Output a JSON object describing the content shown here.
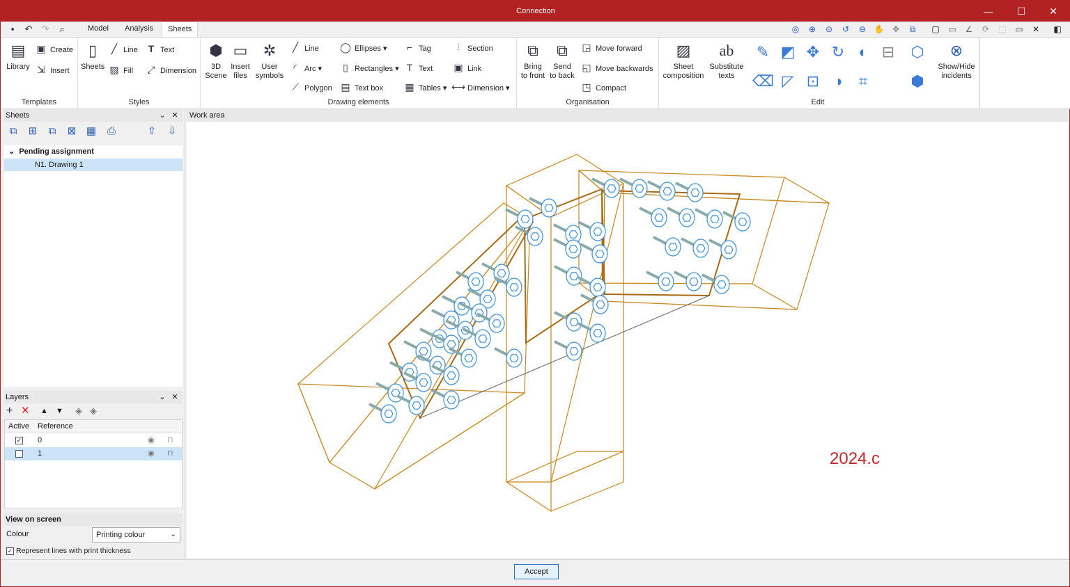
{
  "window": {
    "title": "Connection",
    "minimize_glyph": "—",
    "maximize_glyph": "☐",
    "close_glyph": "✕"
  },
  "tabs": [
    "Model",
    "Analysis",
    "Sheets"
  ],
  "ribbon": {
    "templates": {
      "label": "Templates",
      "library": "Library",
      "create": "Create",
      "insert": "Insert"
    },
    "styles": {
      "label": "Styles",
      "sheets": "Sheets",
      "line": "Line",
      "fill": "Fill",
      "text": "Text",
      "dimension": "Dimension"
    },
    "drawing": {
      "label": "Drawing elements",
      "scene": [
        "3D",
        "Scene"
      ],
      "insert_files": [
        "Insert",
        "files"
      ],
      "user_symbols": [
        "User",
        "symbols"
      ],
      "line": "Line",
      "arc": "Arc",
      "polygon": "Polygon",
      "ellipses": "Ellipses",
      "rectangles": "Rectangles",
      "text_box": "Text box",
      "tag": "Tag",
      "text": "Text",
      "tables": "Tables",
      "section": "Section",
      "link": "Link",
      "dimension": "Dimension"
    },
    "organisation": {
      "label": "Organisation",
      "bring_front": [
        "Bring",
        "to front"
      ],
      "send_back": [
        "Send",
        "to back"
      ],
      "move_forward": "Move forward",
      "move_backwards": "Move backwards",
      "compact": "Compact"
    },
    "composition": {
      "sheet_composition": [
        "Sheet",
        "composition"
      ],
      "substitute_texts": [
        "Substitute",
        "texts"
      ]
    },
    "edit": {
      "label": "Edit"
    },
    "incidents": [
      "Show/Hide",
      "incidents"
    ]
  },
  "sheets_panel": {
    "title": "Sheets",
    "group": "Pending assignment",
    "item": "N1. Drawing 1"
  },
  "layers_panel": {
    "title": "Layers",
    "col_active": "Active",
    "col_reference": "Reference",
    "rows": [
      {
        "reference": "0",
        "active": true
      },
      {
        "reference": "1",
        "active": false
      }
    ]
  },
  "view_on_screen": {
    "title": "View on screen",
    "colour_label": "Colour",
    "colour_value": "Printing colour",
    "print_thickness_label": "Represent lines with print thickness",
    "print_thickness_checked": true
  },
  "work_area": {
    "title": "Work area",
    "watermark": "2024.c",
    "watermark_color": "#c0272d",
    "steel_color": "#c8861e",
    "bolt_color": "#3a8fd8"
  },
  "footer": {
    "accept": "Accept"
  }
}
